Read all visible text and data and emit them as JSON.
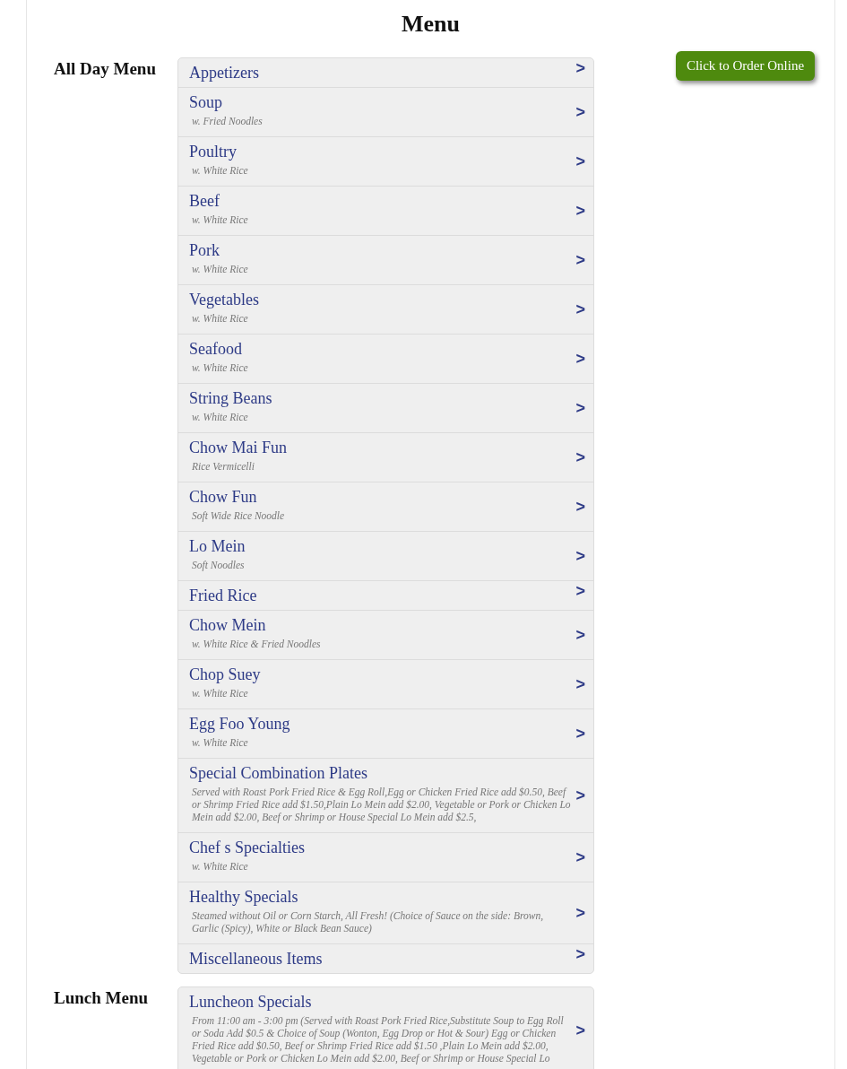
{
  "page_title": "Menu",
  "order_button": "Click to Order Online",
  "sections": [
    {
      "title": "All Day Menu",
      "items": [
        {
          "title": "Appetizers",
          "arrow": ">"
        },
        {
          "title": "Soup",
          "subtitle": "w. Fried Noodles",
          "arrow": ">"
        },
        {
          "title": "Poultry",
          "subtitle": "w. White Rice",
          "arrow": ">"
        },
        {
          "title": "Beef",
          "subtitle": "w. White Rice",
          "arrow": ">"
        },
        {
          "title": "Pork",
          "subtitle": "w. White Rice",
          "arrow": ">"
        },
        {
          "title": "Vegetables",
          "subtitle": "w. White Rice",
          "arrow": ">"
        },
        {
          "title": "Seafood",
          "subtitle": "w. White Rice",
          "arrow": ">"
        },
        {
          "title": "String Beans",
          "subtitle": "w. White Rice",
          "arrow": ">"
        },
        {
          "title": "Chow Mai Fun",
          "subtitle": "Rice Vermicelli",
          "arrow": ">"
        },
        {
          "title": "Chow Fun",
          "subtitle": "Soft Wide Rice Noodle",
          "arrow": ">"
        },
        {
          "title": "Lo Mein",
          "subtitle": "Soft Noodles",
          "arrow": ">"
        },
        {
          "title": "Fried Rice",
          "arrow": ">"
        },
        {
          "title": "Chow Mein",
          "subtitle": "w. White Rice & Fried Noodles",
          "arrow": ">"
        },
        {
          "title": "Chop Suey",
          "subtitle": "w. White Rice",
          "arrow": ">"
        },
        {
          "title": "Egg Foo Young",
          "subtitle": "w. White Rice",
          "arrow": ">"
        },
        {
          "title": "Special Combination Plates",
          "subtitle": "Served with Roast Pork Fried Rice & Egg Roll,Egg or Chicken Fried Rice add $0.50, Beef or Shrimp Fried Rice add $1.50,Plain Lo Mein add $2.00, Vegetable or Pork or Chicken Lo Mein add $2.00, Beef or Shrimp or House Special Lo Mein add $2.5,",
          "arrow": ">"
        },
        {
          "title": "Chef s Specialties",
          "subtitle": "w. White Rice",
          "arrow": ">"
        },
        {
          "title": "Healthy Specials",
          "subtitle": "Steamed without Oil or Corn Starch, All Fresh! (Choice of Sauce on the side: Brown, Garlic (Spicy), White or Black Bean Sauce)",
          "arrow": ">"
        },
        {
          "title": "Miscellaneous Items",
          "arrow": ">"
        }
      ]
    },
    {
      "title": "Lunch Menu",
      "items": [
        {
          "title": "Luncheon Specials",
          "subtitle": "From 11:00 am - 3:00 pm (Served with Roast Pork Fried Rice,Substitute Soup to Egg Roll or Soda Add $0.5 & Choice of Soup (Wonton, Egg Drop or Hot & Sour) Egg or Chicken Fried Rice add $0.50, Beef or Shrimp Fried Rice add $1.50 ,Plain Lo Mein add $2.00, Vegetable or Pork or Chicken Lo Mein add $2.00, Beef or Shrimp or House Special Lo",
          "arrow": ">"
        }
      ]
    }
  ]
}
